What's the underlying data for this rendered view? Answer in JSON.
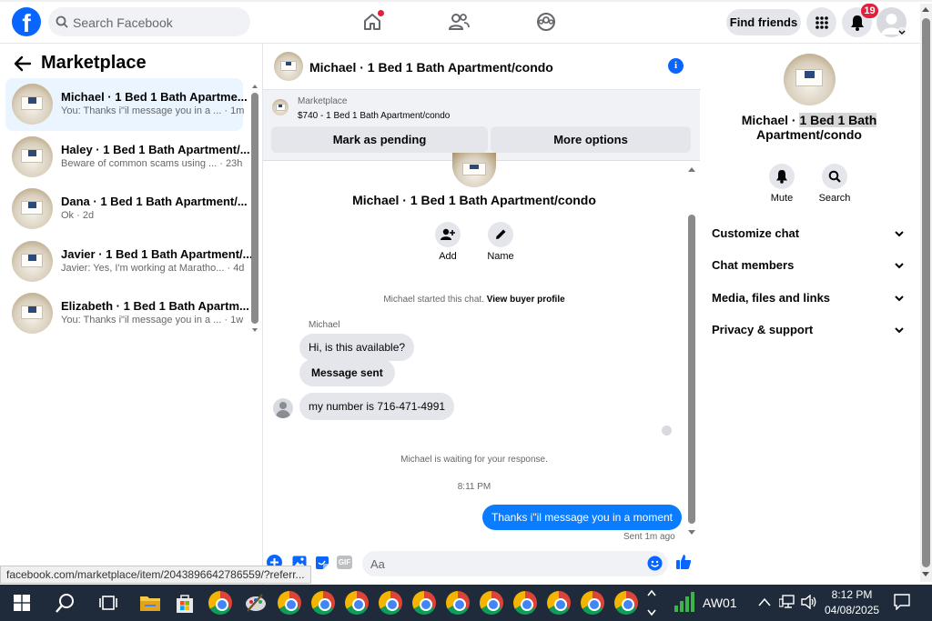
{
  "topbar": {
    "logo_letter": "f",
    "search_placeholder": "Search Facebook",
    "find_friends_label": "Find friends",
    "notifications_count": "19"
  },
  "marketplace": {
    "title": "Marketplace",
    "conversations": [
      {
        "name": "Michael · 1 Bed 1 Bath Apartme...",
        "preview": "You: Thanks i\"il message you in a ...",
        "time": "· 1m",
        "selected": true
      },
      {
        "name": "Haley · 1 Bed 1 Bath Apartment/...",
        "preview": "Beware of common scams using ...",
        "time": "· 23h",
        "selected": false
      },
      {
        "name": "Dana · 1 Bed 1 Bath Apartment/...",
        "preview": "Ok",
        "time": "· 2d",
        "selected": false
      },
      {
        "name": "Javier · 1 Bed 1 Bath Apartment/...",
        "preview": "Javier: Yes, I'm working at Maratho...",
        "time": "· 4d",
        "selected": false
      },
      {
        "name": "Elizabeth · 1 Bed 1 Bath Apartm...",
        "preview": "You: Thanks i\"il message you in a ...",
        "time": "· 1w",
        "selected": false
      }
    ]
  },
  "chat": {
    "header_title": "Michael · 1 Bed 1 Bath Apartment/condo",
    "listing_label": "Marketplace",
    "listing_price": "$740 - 1 Bed 1 Bath Apartment/condo",
    "mark_pending_label": "Mark as pending",
    "more_options_label": "More options",
    "conversation_title": "Michael · 1 Bed 1 Bath Apartment/condo",
    "add_label": "Add",
    "name_label": "Name",
    "started_text": "Michael started this chat.",
    "view_buyer_profile": "View buyer profile",
    "sender_name": "Michael",
    "messages": [
      "Hi, is this available?",
      "Message sent",
      "my number is 716-471-4991"
    ],
    "waiting_text": "Michael is waiting for your response.",
    "timestamp": "8:11 PM",
    "my_message": "Thanks i\"il message you in a moment",
    "sent_status": "Sent 1m ago",
    "composer_placeholder": "Aa",
    "gif_label": "GIF"
  },
  "right_panel": {
    "title_plain": "Michael · ",
    "title_highlight": "1 Bed 1 Bath",
    "title_line2": "Apartment/condo",
    "mute_label": "Mute",
    "search_label": "Search",
    "sections": [
      "Customize chat",
      "Chat members",
      "Media, files and links",
      "Privacy & support"
    ]
  },
  "status_url": "facebook.com/marketplace/item/2043896642786559/?referr...",
  "taskbar": {
    "app_label": "AW01",
    "time": "8:12 PM",
    "date": "04/08/2025"
  },
  "colors": {
    "brand_blue": "#0866ff",
    "messenger_blue": "#0a7cff",
    "badge_red": "#e41e3f",
    "taskbar": "#1f2b3a"
  }
}
